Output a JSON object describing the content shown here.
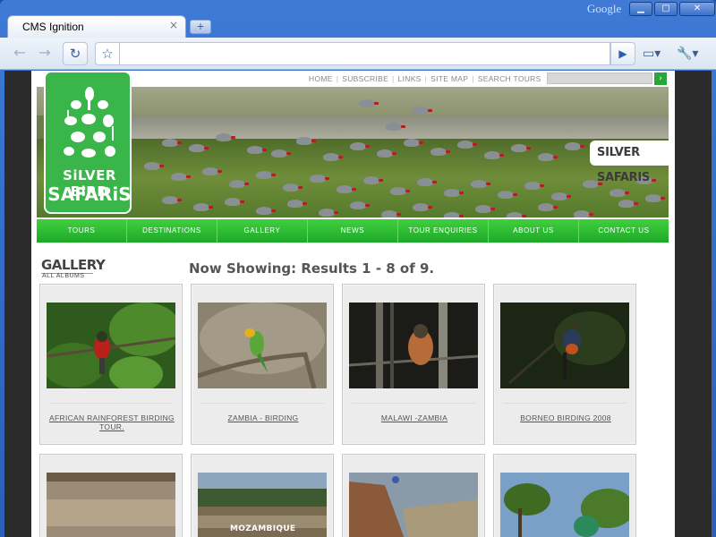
{
  "browser": {
    "brand": "Google",
    "tab_title": "CMS Ignition",
    "tab_close_glyph": "×",
    "new_tab_glyph": "+",
    "url": "",
    "window_buttons": {
      "minimize": "▁",
      "maximize": "▢",
      "close": "✕"
    },
    "icons": {
      "back": "back-arrow-icon",
      "forward": "forward-arrow-icon",
      "reload": "reload-icon",
      "star": "star-icon",
      "go": "play-icon",
      "page": "page-icon",
      "tools": "wrench-icon"
    }
  },
  "site": {
    "topnav": [
      "HOME",
      "SUBSCRIBE",
      "LINKS",
      "SITE MAP",
      "SEARCH TOURS"
    ],
    "search_go_glyph": "›",
    "logo": {
      "line1": "SiLVER BiRD",
      "line2": "SAFARiS"
    },
    "banner_tag": "SILVER SAFARIS",
    "mainnav": [
      "TOURS",
      "DESTINATIONS",
      "GALLERY",
      "NEWS",
      "TOUR ENQUIRIES",
      "ABOUT US",
      "CONTACT US"
    ],
    "gallery": {
      "title": "GALLERY",
      "subtitle": "ALL ALBUMS",
      "results": "Now Showing: Results 1 - 8 of 9."
    },
    "albums": [
      {
        "title": "AFRICAN RAINFOREST BIRDING TOUR."
      },
      {
        "title": "ZAMBIA - BIRDING"
      },
      {
        "title": "MALAWI -ZAMBIA"
      },
      {
        "title": "BORNEO BIRDING 2008"
      },
      {
        "title": ""
      },
      {
        "title": "",
        "overlay": "MOZAMBIQUE"
      },
      {
        "title": ""
      },
      {
        "title": ""
      }
    ],
    "colors": {
      "brand_green": "#39b54a",
      "nav_green": "#22ac2c"
    }
  }
}
